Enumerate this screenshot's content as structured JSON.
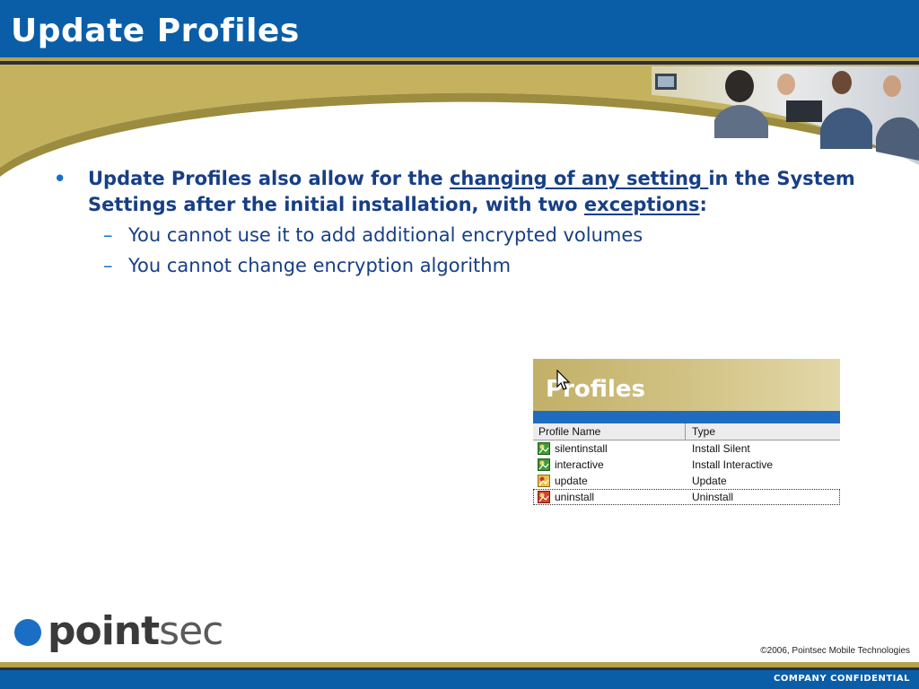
{
  "slide": {
    "title": "Update Profiles",
    "bullet": {
      "part1": "Update Profiles also allow for the ",
      "link1": "changing of any setting ",
      "part2": "in the System Settings after the initial installation, with two ",
      "link2": "exceptions",
      "part3": ":"
    },
    "sub_bullets": [
      "You cannot use it to add additional encrypted volumes",
      "You cannot change encryption algorithm"
    ]
  },
  "profiles_panel": {
    "title": "Profiles",
    "columns": [
      "Profile Name",
      "Type"
    ],
    "rows": [
      {
        "name": "silentinstall",
        "type": "Install Silent",
        "icon": "profile-green-icon"
      },
      {
        "name": "interactive",
        "type": "Install Interactive",
        "icon": "profile-green-icon"
      },
      {
        "name": "update",
        "type": "Update",
        "icon": "profile-yellow-icon"
      },
      {
        "name": "uninstall",
        "type": "Uninstall",
        "icon": "profile-red-icon"
      }
    ]
  },
  "footer": {
    "logo_point": "point",
    "logo_sec": "sec",
    "copyright": "©2006, Pointsec Mobile Technologies",
    "confidential": "COMPANY CONFIDENTIAL"
  },
  "colors": {
    "header_blue": "#0a5ea8",
    "gold": "#b7a24c",
    "text_navy": "#173f86"
  }
}
